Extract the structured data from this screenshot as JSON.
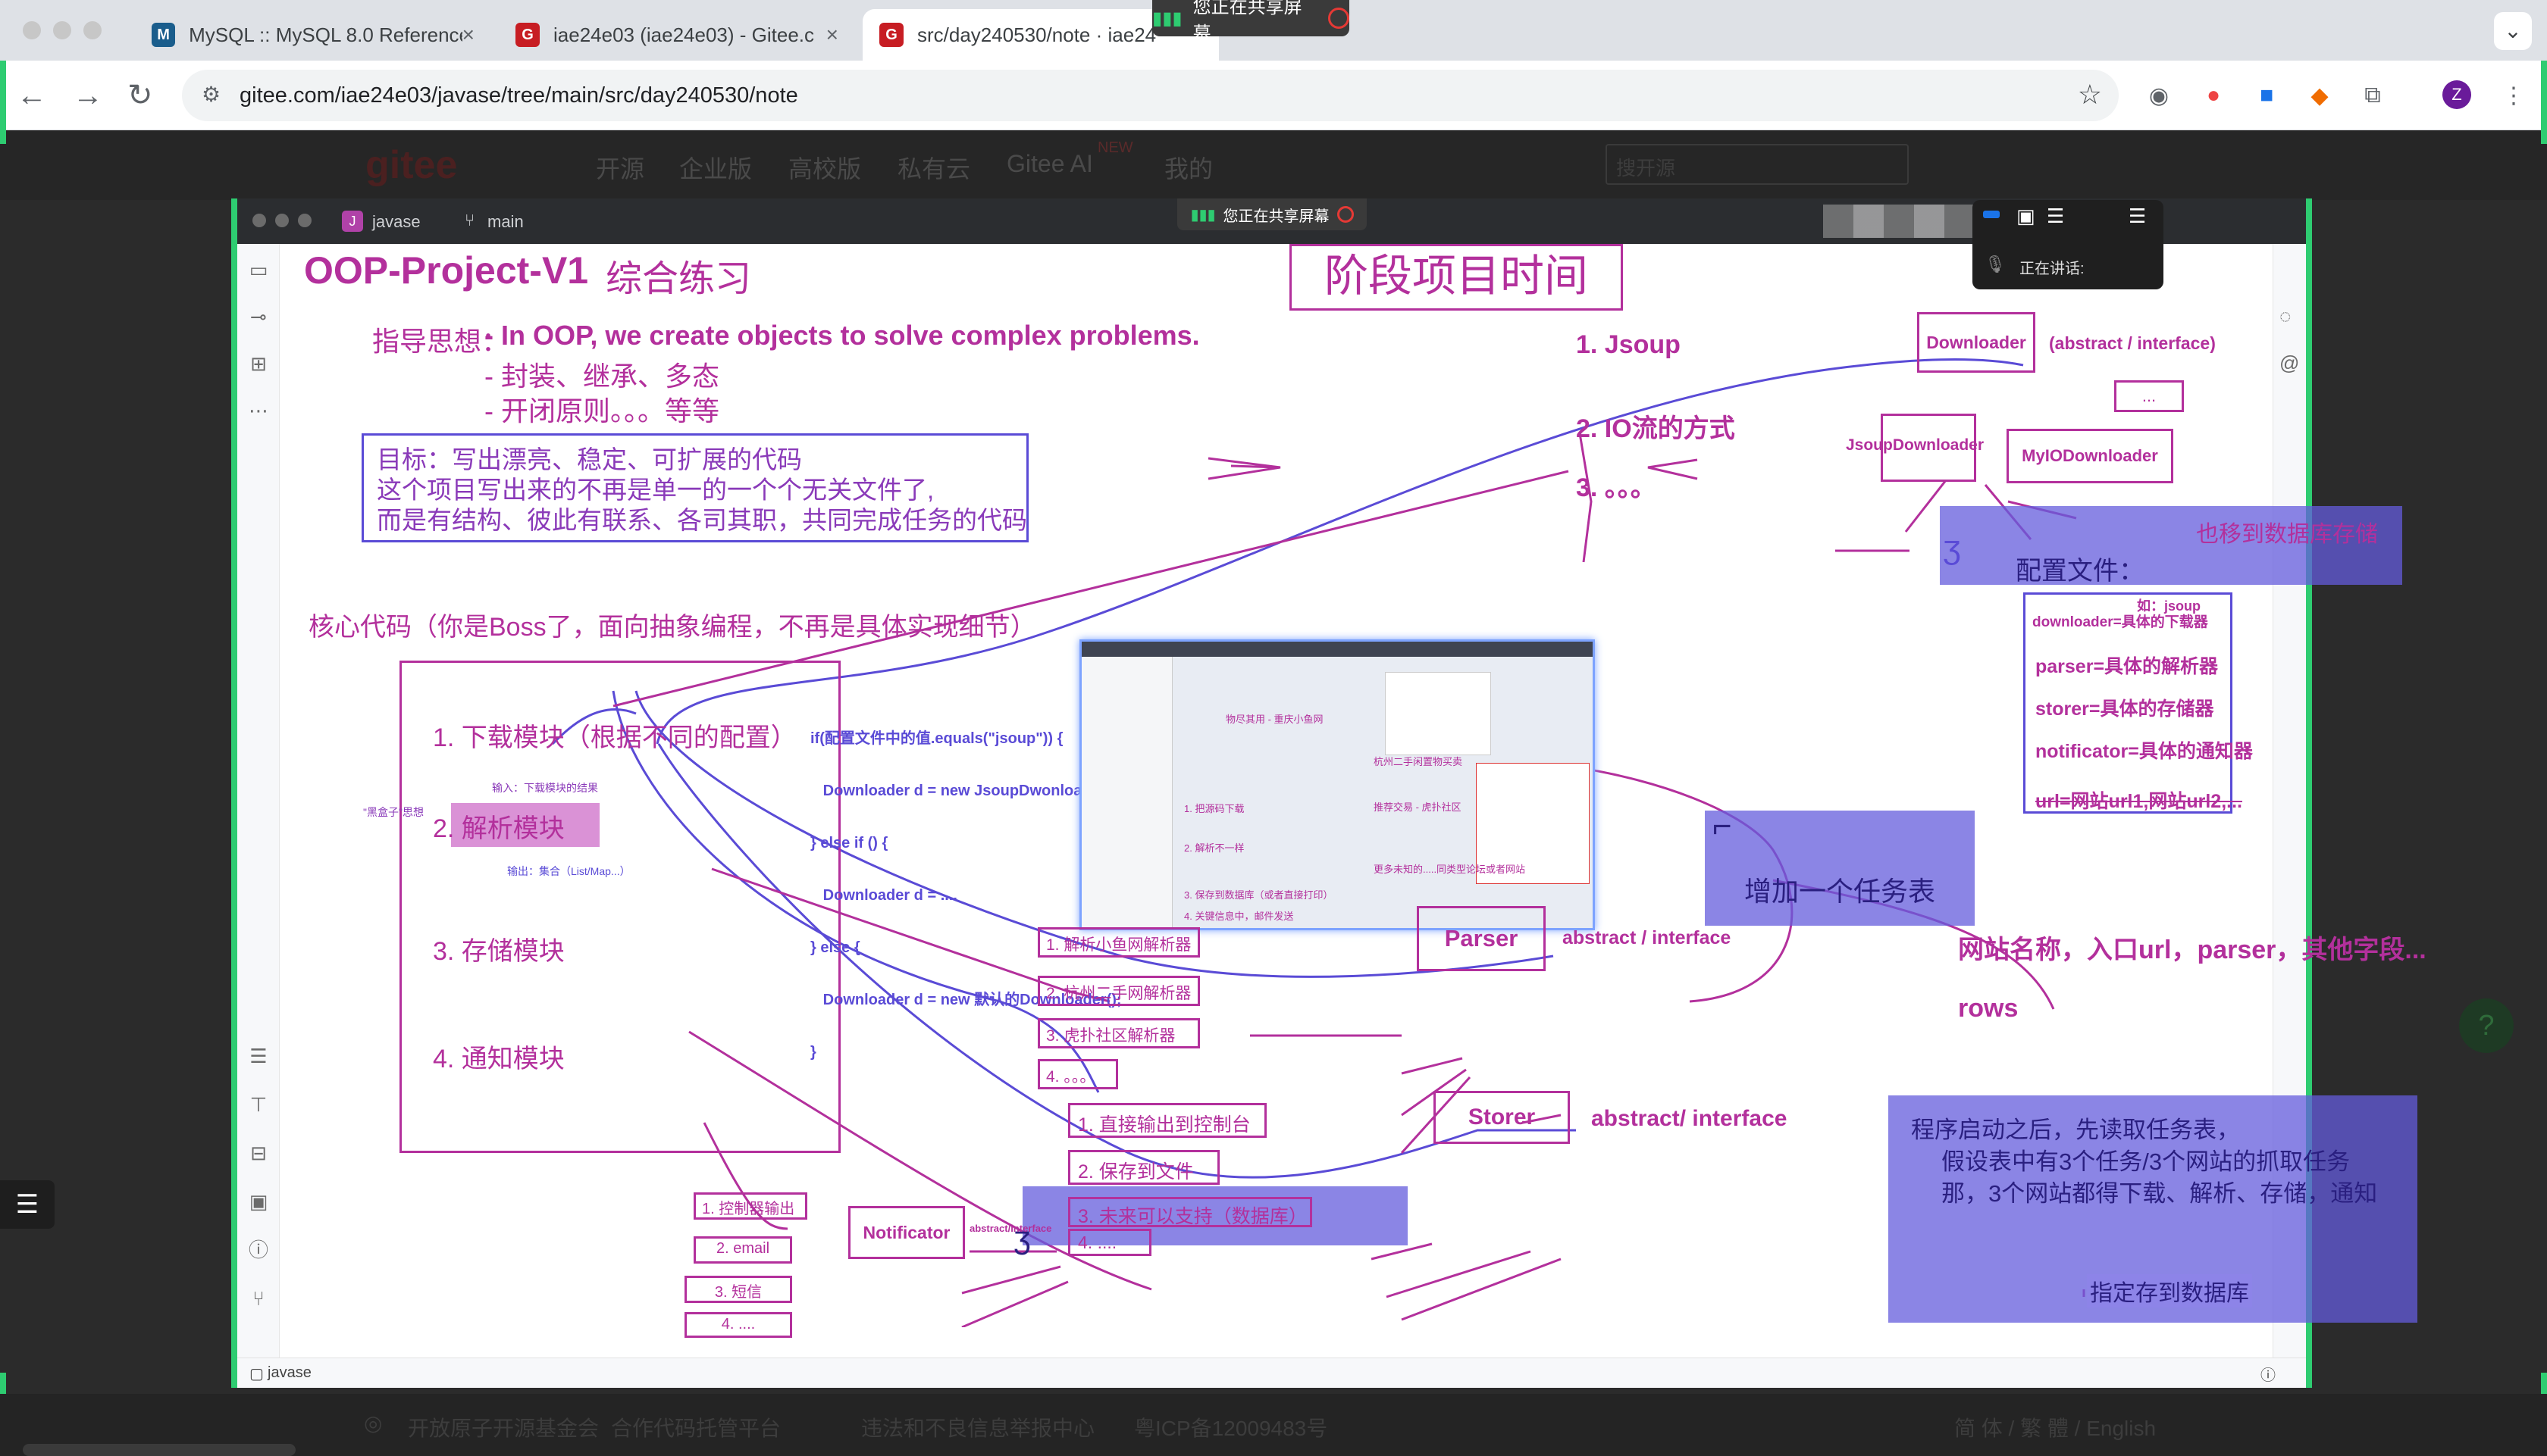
{
  "browser": {
    "tabs": [
      {
        "title": "MySQL :: MySQL 8.0 Reference",
        "favicon": "mysql-icon"
      },
      {
        "title": "iae24e03 (iae24e03) - Gitee.c",
        "favicon": "gitee-icon"
      },
      {
        "title": "src/day240530/note · iae24",
        "favicon": "gitee-icon"
      }
    ],
    "url": "gitee.com/iae24e03/javase/tree/main/src/day240530/note",
    "profile_initial": "Z",
    "sharing_banner": "您正在共享屏幕"
  },
  "gitee_nav": {
    "logo": "gitee",
    "items": [
      "开源",
      "企业版",
      "高校版",
      "私有云",
      "Gitee AI",
      "我的"
    ],
    "new_badge": "NEW",
    "search_placeholder": "搜开源"
  },
  "ide": {
    "project": "javase",
    "project_initial": "J",
    "branch": "main",
    "sharing_banner": "您正在共享屏幕",
    "speaking_label": "正在讲话:",
    "bottom_project": "javase"
  },
  "note": {
    "title": "OOP-Project-V1",
    "title_cn": "综合练习",
    "stage_box": "阶段项目时间",
    "guide_label": "指导思想：",
    "guide_lines": [
      "- In OOP, we create objects to solve complex problems.",
      "- 封装、继承、多态",
      "- 开闭原则。。。等等"
    ],
    "goal_lines": [
      "目标：写出漂亮、稳定、可扩展的代码",
      "这个项目写出来的不再是单一的一个个无关文件了,",
      "而是有结构、彼此有联系、各司其职，共同完成任务的代码"
    ],
    "core_code": "核心代码（你是Boss了，面向抽象编程，不再是具体实现细节）",
    "modules": [
      "1. 下载模块（根据不同的配置）",
      "2. 解析模块",
      "3. 存储模块",
      "4. 通知模块"
    ],
    "download_note": "输入：下载模块的结果",
    "parse_output": "输出：集合（List/Map...）",
    "black_box": "\"黑盒子\"思想",
    "code_lines": [
      "if(配置文件中的值.equals(\"jsoup\")) {",
      "   Downloader d = new JsoupDwonloader();",
      "} else if () {",
      "   Downloader d = ....",
      "} else {",
      "   Downloader d = new 默认的Downloader();",
      "}"
    ],
    "download_methods": [
      "1. Jsoup",
      "2. IO流的方式",
      "3. 。。。"
    ],
    "downloader": "Downloader",
    "downloader_type": "(abstract / interface)",
    "jsoup_downloader": "JsoupDownloader",
    "io_downloader": "MyIODownloader",
    "dots": "...",
    "config_title": "配置文件：",
    "config_note": "也移到数据库存储",
    "config_example": "如：jsoup",
    "config_lines": [
      "downloader=具体的下载器",
      "parser=具体的解析器",
      "storer=具体的存储器",
      "notificator=具体的通知器",
      "url=网站url1,网站url2,..."
    ],
    "task_table": "增加一个任务表",
    "task_cols": "网站名称，入口url，parser，其他字段...",
    "rows": "rows",
    "parser": "Parser",
    "parser_type": "abstract / interface",
    "parsers": [
      "1. 解析小鱼网解析器",
      "2. 杭州二手网解析器",
      "3. 虎扑社区解析器",
      "4. 。。。"
    ],
    "storer": "Storer",
    "storer_type": "abstract/ interface",
    "storers": [
      "1. 直接输出到控制台",
      "2. 保存到文件",
      "3. 未来可以支持（数据库）",
      "4. ...."
    ],
    "notificator": "Notificator",
    "notificator_type": "abstract/interface",
    "notifiers": [
      "1. 控制器输出",
      "2. email",
      "3. 短信",
      "4. ...."
    ],
    "program_lines": [
      "程序启动之后，先读取任务表，",
      "假设表中有3个任务/3个网站的抓取任务",
      "那，3个网站都得下载、解析、存储，通知"
    ],
    "store_db": "指定存到数据库",
    "thumb_labels": [
      "物尽其用 - 重庆小鱼网",
      "杭州二手闲置物买卖",
      "推荐交易 - 虎扑社区",
      "1. 把源码下载",
      "2. 解析不一样",
      "3. 保存到数据库（或者直接打印）",
      "4. 关键信息中，邮件发送",
      "更多未知的.....同类型论坛或者网站"
    ]
  },
  "footer": {
    "items": [
      "开放原子开源基金会",
      "合作代码托管平台",
      "违法和不良信息举报中心",
      "粤ICP备12009483号",
      "简 体 / 繁 體 / English"
    ]
  },
  "colors": {
    "ink": "#b3309c",
    "blue_ink": "#5a4bd6",
    "highlight": "#6b5fe0",
    "share_green": "#2ecc71"
  }
}
